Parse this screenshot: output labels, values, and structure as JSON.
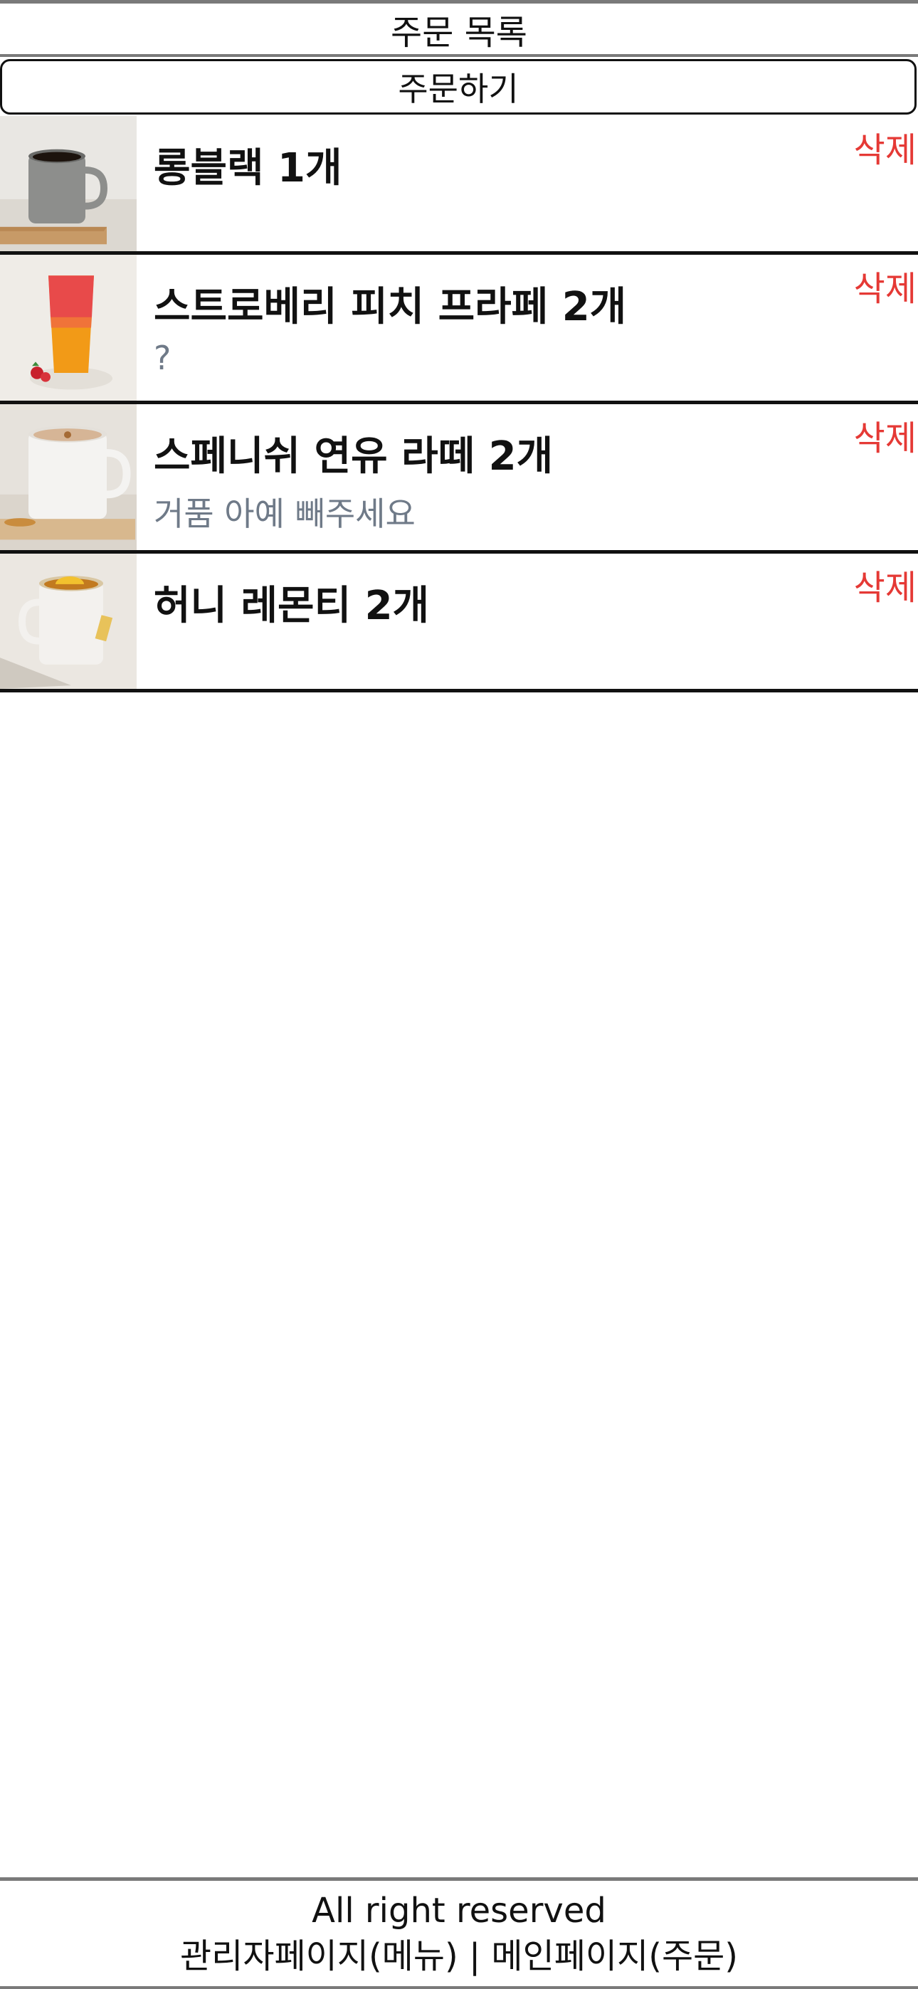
{
  "header": {
    "title": "주문 목록"
  },
  "order_button": {
    "label": "주문하기"
  },
  "orders": [
    {
      "title": "롱블랙 1개",
      "memo": "",
      "delete_label": "삭제",
      "image_icon": "coffee-mug-black"
    },
    {
      "title": "스트로베리 피치 프라페 2개",
      "memo": "?",
      "delete_label": "삭제",
      "image_icon": "frappe-glass"
    },
    {
      "title": "스페니쉬 연유 라떼 2개",
      "memo": "거품 아예 빼주세요",
      "delete_label": "삭제",
      "image_icon": "latte-mug"
    },
    {
      "title": "허니 레몬티 2개",
      "memo": "",
      "delete_label": "삭제",
      "image_icon": "tea-mug"
    }
  ],
  "footer": {
    "copyright": "All right reserved",
    "admin_link": "관리자페이지(메뉴)",
    "separator": " | ",
    "main_link": "메인페이지(주문)"
  },
  "colors": {
    "delete": "#e53935",
    "memo": "#6f7a88",
    "border": "#111111",
    "header_border": "#7a7a7a"
  }
}
